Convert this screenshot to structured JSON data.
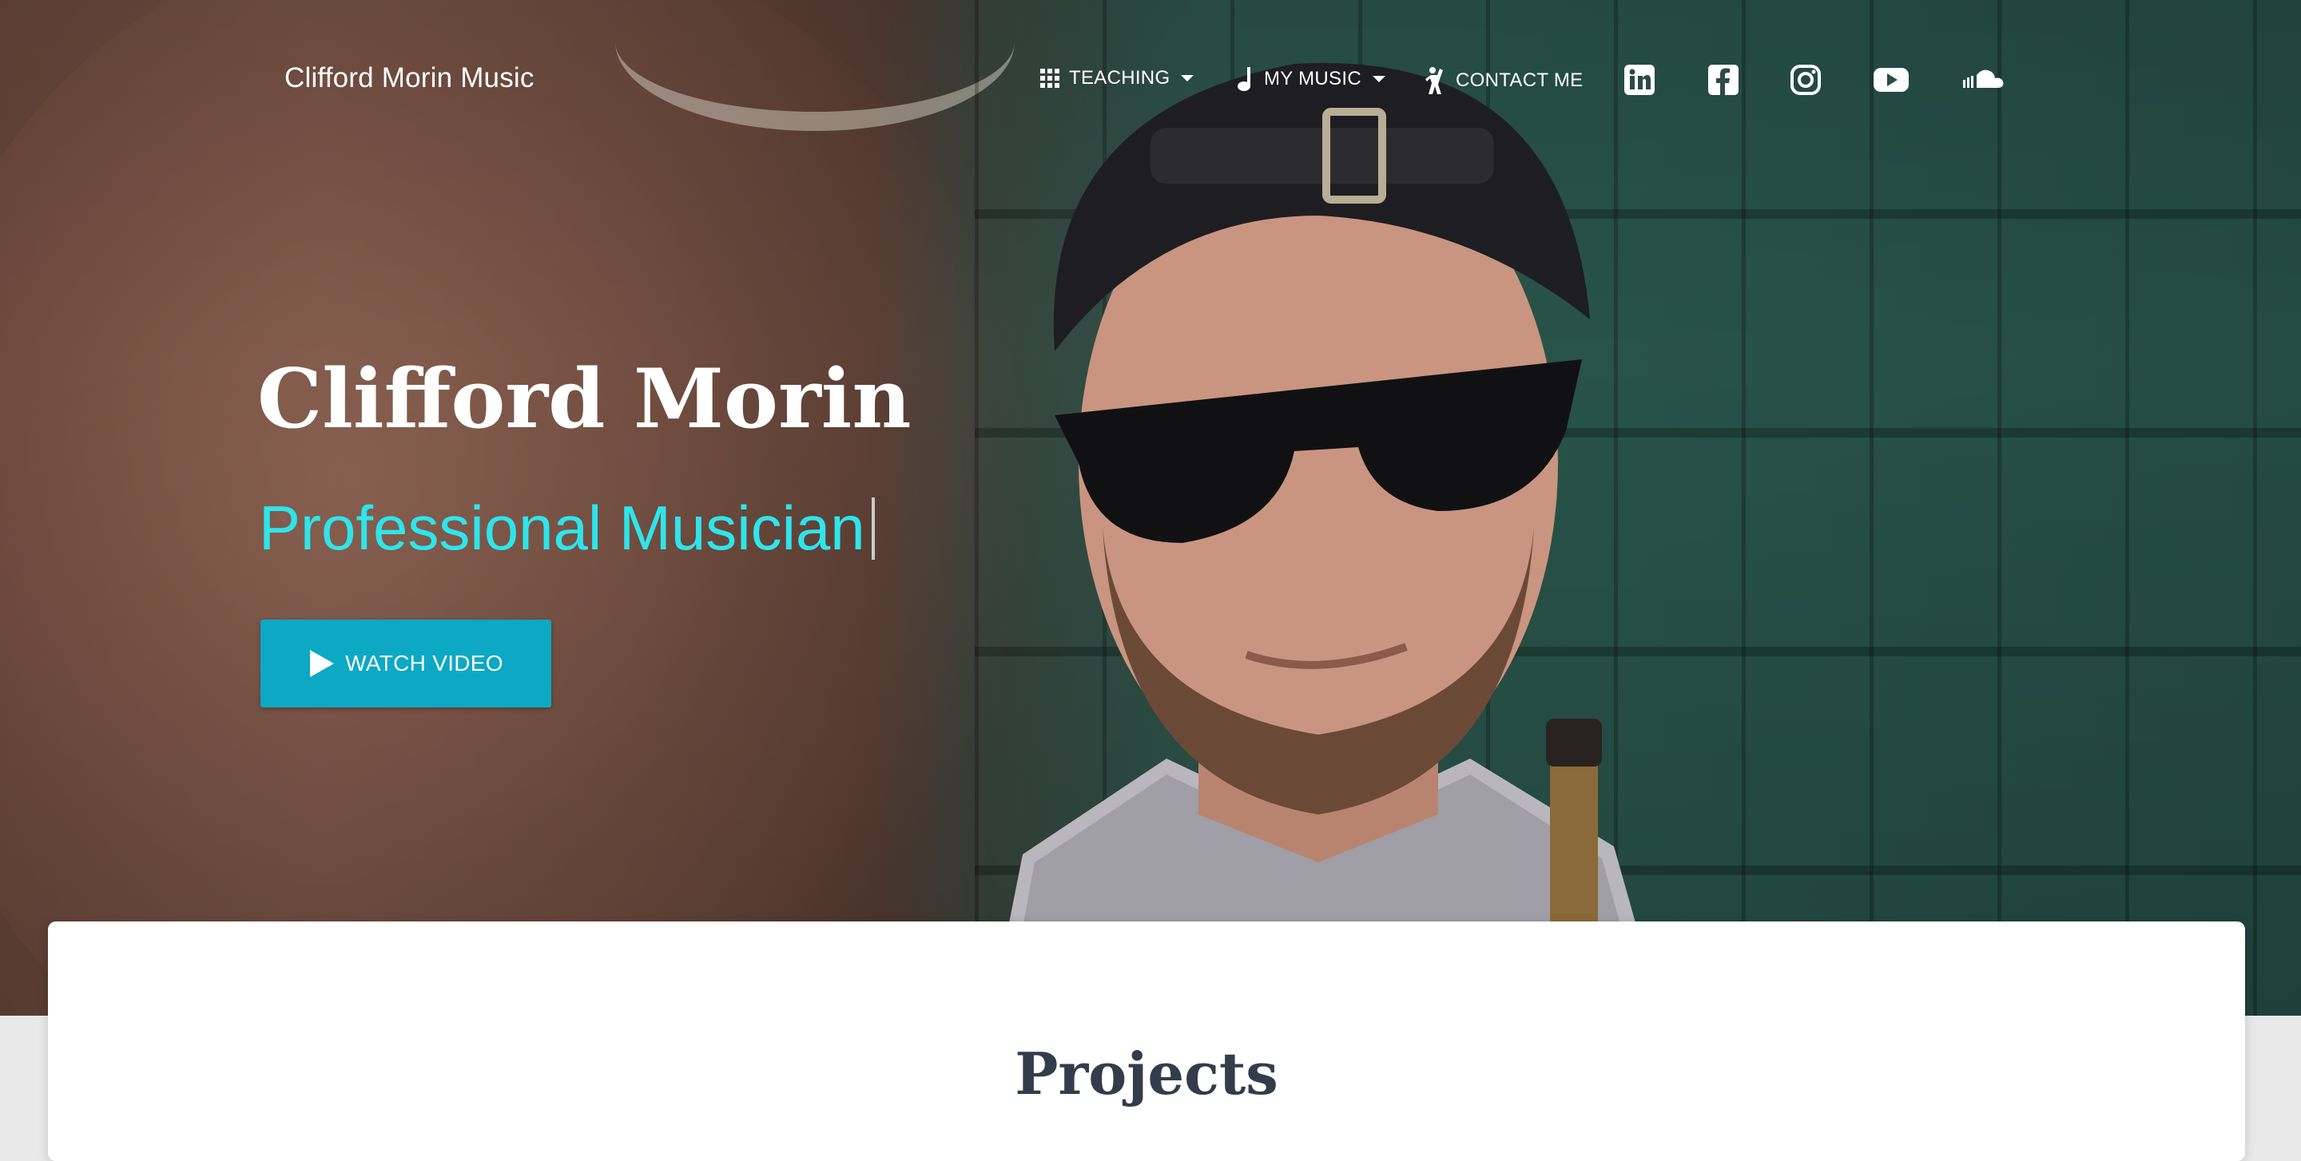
{
  "header": {
    "brand": "Clifford Morin Music",
    "nav": [
      {
        "label": "TEACHING",
        "icon": "grid-icon",
        "has_dropdown": true
      },
      {
        "label": "MY MUSIC",
        "icon": "music-note-icon",
        "has_dropdown": true
      },
      {
        "label": "CONTACT ME",
        "icon": "person-icon",
        "has_dropdown": false
      }
    ],
    "social": [
      {
        "name": "linkedin-icon"
      },
      {
        "name": "facebook-icon"
      },
      {
        "name": "instagram-icon"
      },
      {
        "name": "youtube-icon"
      },
      {
        "name": "soundcloud-icon"
      }
    ]
  },
  "hero": {
    "title": "Clifford Morin",
    "subtitle": "Professional Musician",
    "button_label": "WATCH VIDEO",
    "button_icon": "play-icon"
  },
  "section": {
    "title": "Projects"
  },
  "colors": {
    "accent_subtitle": "#2ee5ec",
    "button_bg": "#0da8c4",
    "heading_dark": "#333c4a"
  }
}
